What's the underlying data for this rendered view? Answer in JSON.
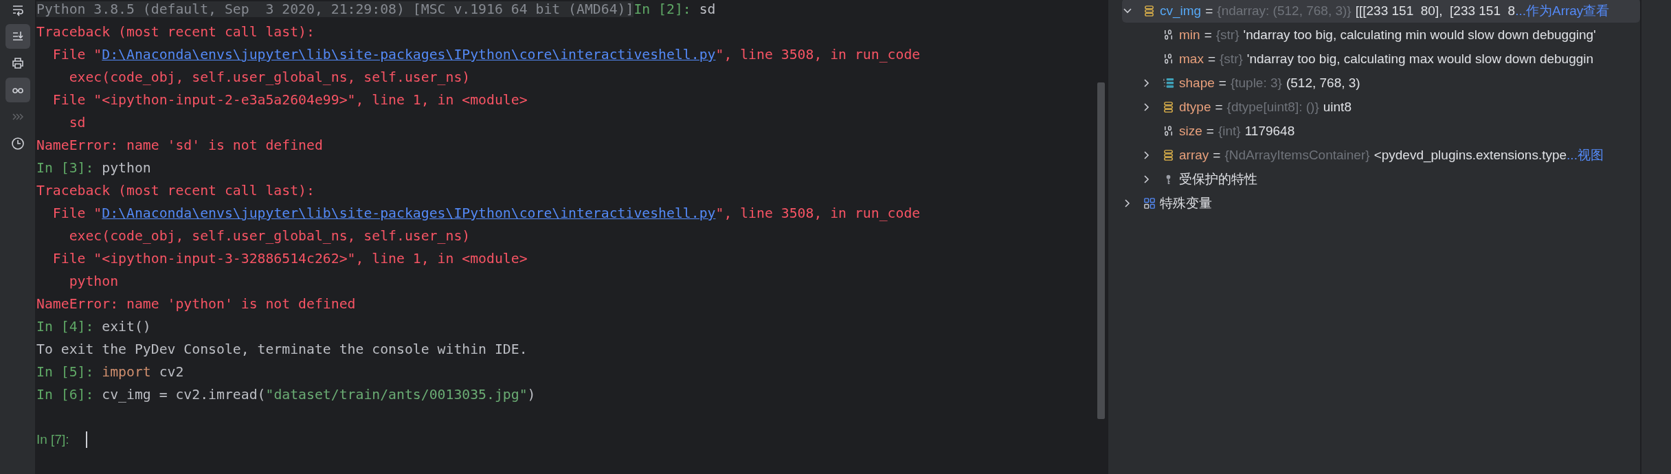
{
  "toolbar": [
    {
      "kind": "wrap",
      "selected": false,
      "disabled": false
    },
    {
      "kind": "scroll-end",
      "selected": true,
      "disabled": false
    },
    {
      "kind": "print",
      "selected": false,
      "disabled": false
    },
    {
      "kind": "glasses",
      "selected": true,
      "disabled": false
    },
    {
      "kind": "more",
      "selected": false,
      "disabled": true
    },
    {
      "kind": "history",
      "selected": false,
      "disabled": false
    }
  ],
  "console": {
    "lines": [
      {
        "segments": [
          {
            "kind": "banner",
            "text": "Python 3.8.5 (default, Sep  3 2020, 21:29:08) [MSC v.1916 64 bit (AMD64)]"
          },
          {
            "kind": "prompt",
            "text": "In [2]: "
          },
          {
            "kind": "input",
            "text": "sd"
          }
        ]
      },
      {
        "segments": [
          {
            "kind": "error",
            "text": "Traceback (most recent call last):"
          }
        ]
      },
      {
        "segments": [
          {
            "kind": "error",
            "text": "  File \""
          },
          {
            "kind": "link",
            "text": "D:\\Anaconda\\envs\\jupyter\\lib\\site-packages\\IPython\\core\\interactiveshell.py"
          },
          {
            "kind": "error",
            "text": "\", line 3508, in run_code"
          }
        ]
      },
      {
        "segments": [
          {
            "kind": "error",
            "text": "    exec(code_obj, self.user_global_ns, self.user_ns)"
          }
        ]
      },
      {
        "segments": [
          {
            "kind": "error",
            "text": "  File \"<ipython-input-2-e3a5a2604e99>\", line 1, in <module>"
          }
        ]
      },
      {
        "segments": [
          {
            "kind": "error",
            "text": "    sd"
          }
        ]
      },
      {
        "segments": [
          {
            "kind": "error",
            "text": "NameError: name 'sd' is not defined"
          }
        ]
      },
      {
        "segments": [
          {
            "kind": "prompt",
            "text": "In [3]: "
          },
          {
            "kind": "input",
            "text": "python"
          }
        ]
      },
      {
        "segments": [
          {
            "kind": "error",
            "text": "Traceback (most recent call last):"
          }
        ]
      },
      {
        "segments": [
          {
            "kind": "error",
            "text": "  File \""
          },
          {
            "kind": "link",
            "text": "D:\\Anaconda\\envs\\jupyter\\lib\\site-packages\\IPython\\core\\interactiveshell.py"
          },
          {
            "kind": "error",
            "text": "\", line 3508, in run_code"
          }
        ]
      },
      {
        "segments": [
          {
            "kind": "error",
            "text": "    exec(code_obj, self.user_global_ns, self.user_ns)"
          }
        ]
      },
      {
        "segments": [
          {
            "kind": "error",
            "text": "  File \"<ipython-input-3-32886514c262>\", line 1, in <module>"
          }
        ]
      },
      {
        "segments": [
          {
            "kind": "error",
            "text": "    python"
          }
        ]
      },
      {
        "segments": [
          {
            "kind": "error",
            "text": "NameError: name 'python' is not defined"
          }
        ]
      },
      {
        "segments": [
          {
            "kind": "prompt",
            "text": "In [4]: "
          },
          {
            "kind": "input",
            "text": "exit()"
          }
        ]
      },
      {
        "segments": [
          {
            "kind": "output",
            "text": "To exit the PyDev Console, terminate the console within IDE."
          }
        ]
      },
      {
        "segments": [
          {
            "kind": "prompt",
            "text": "In [5]: "
          },
          {
            "kind": "keyword",
            "text": "import"
          },
          {
            "kind": "input",
            "text": " cv2"
          }
        ]
      },
      {
        "segments": [
          {
            "kind": "prompt",
            "text": "In [6]: "
          },
          {
            "kind": "input",
            "text": "cv_img = cv2.imread("
          },
          {
            "kind": "string",
            "text": "\"dataset/train/ants/0013035.jpg\""
          },
          {
            "kind": "input",
            "text": ")"
          }
        ]
      }
    ],
    "prompt": "In [7]:"
  },
  "variables": {
    "items": [
      {
        "kind": "array",
        "name": "cv_img",
        "sign": "=",
        "type": "{ndarray: (512, 768, 3)}",
        "value": "[[[233 151  80],  [233 151  8",
        "link": "...作为Array查看",
        "expanded": true,
        "selected": true,
        "children": [
          {
            "kind": "number",
            "name": "min",
            "sign": "=",
            "type": "{str}",
            "value": "'ndarray too big, calculating min would slow down debugging'",
            "selected": false
          },
          {
            "kind": "number",
            "name": "max",
            "sign": "=",
            "type": "{str}",
            "value": "'ndarray too big, calculating max would slow down debuggin",
            "selected": false
          },
          {
            "kind": "tuple",
            "name": "shape",
            "sign": "=",
            "type": "{tuple: 3}",
            "value": "(512, 768, 3)",
            "expanded": false,
            "selected": false
          },
          {
            "kind": "array",
            "name": "dtype",
            "sign": "=",
            "type": "{dtype[uint8]: ()}",
            "value": "uint8",
            "expanded": false,
            "selected": false
          },
          {
            "kind": "number",
            "name": "size",
            "sign": "=",
            "type": "{int}",
            "value": "1179648",
            "selected": false
          },
          {
            "kind": "array",
            "name": "array",
            "sign": "=",
            "type": "{NdArrayItemsContainer}",
            "value": "<pydevd_plugins.extensions.type",
            "link": "...视图",
            "expanded": false,
            "selected": false
          },
          {
            "kind": "protected",
            "name": "受保护的特性",
            "expanded": false,
            "selected": false
          }
        ]
      },
      {
        "kind": "special",
        "name": "特殊变量",
        "expanded": false,
        "selected": false
      }
    ]
  }
}
